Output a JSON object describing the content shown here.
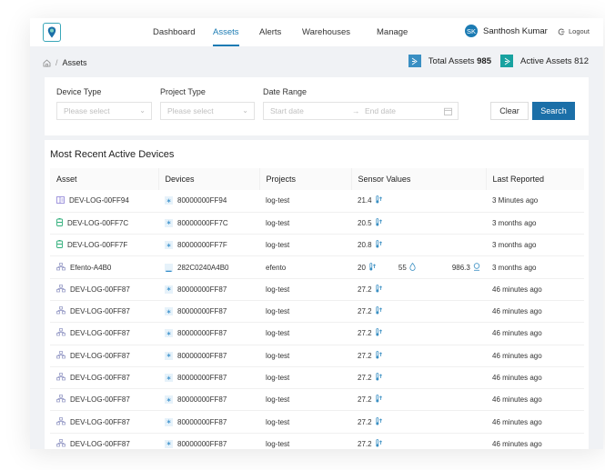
{
  "nav": {
    "items": [
      {
        "label": "Dashboard",
        "active": false
      },
      {
        "label": "Assets",
        "active": true
      },
      {
        "label": "Alerts",
        "active": false
      },
      {
        "label": "Warehouses",
        "active": false
      },
      {
        "label": "Manage",
        "active": false
      }
    ],
    "user": {
      "initials": "SK",
      "name": "Santhosh Kumar"
    },
    "logout_label": "Logout"
  },
  "breadcrumb": {
    "separator": "/",
    "current": "Assets"
  },
  "stats": {
    "total": {
      "label": "Total Assets",
      "value": "985",
      "color": "#3a8fc3"
    },
    "active": {
      "label": "Active Assets",
      "value": "812",
      "color": "#18a2a0"
    }
  },
  "filters": {
    "device_type": {
      "label": "Device Type",
      "placeholder": "Please select"
    },
    "project_type": {
      "label": "Project Type",
      "placeholder": "Please select"
    },
    "date_range": {
      "label": "Date Range",
      "start_placeholder": "Start date",
      "end_placeholder": "End date"
    },
    "clear_label": "Clear",
    "search_label": "Search"
  },
  "table": {
    "title": "Most Recent Active Devices",
    "columns": [
      "Asset",
      "Devices",
      "Projects",
      "Sensor Values",
      "Last Reported"
    ],
    "rows": [
      {
        "asset_icon": "tag-icon",
        "asset": "DEV-LOG-00FF94",
        "device_icon": "bluetooth-icon",
        "device": "80000000FF94",
        "project": "log-test",
        "sensors": [
          {
            "value": "21.4",
            "icon": "thermometer-icon"
          }
        ],
        "last": "3 Minutes ago"
      },
      {
        "asset_icon": "battery-icon",
        "asset": "DEV-LOG-00FF7C",
        "device_icon": "bluetooth-icon",
        "device": "80000000FF7C",
        "project": "log-test",
        "sensors": [
          {
            "value": "20.5",
            "icon": "thermometer-icon"
          }
        ],
        "last": "3 months ago"
      },
      {
        "asset_icon": "battery-icon",
        "asset": "DEV-LOG-00FF7F",
        "device_icon": "bluetooth-icon",
        "device": "80000000FF7F",
        "project": "log-test",
        "sensors": [
          {
            "value": "20.8",
            "icon": "thermometer-icon"
          }
        ],
        "last": "3 months ago"
      },
      {
        "asset_icon": "network-icon",
        "asset": "Efento-A4B0",
        "device_icon": "gauge-icon",
        "device": "282C0240A4B0",
        "project": "efento",
        "sensors": [
          {
            "value": "20",
            "icon": "thermometer-icon"
          },
          {
            "value": "55",
            "icon": "humidity-icon"
          },
          {
            "value": "986.3",
            "icon": "pressure-icon"
          }
        ],
        "last": "3 months ago"
      },
      {
        "asset_icon": "network-icon",
        "asset": "DEV-LOG-00FF87",
        "device_icon": "bluetooth-icon",
        "device": "80000000FF87",
        "project": "log-test",
        "sensors": [
          {
            "value": "27.2",
            "icon": "thermometer-icon"
          }
        ],
        "last": "46 minutes ago"
      },
      {
        "asset_icon": "network-icon",
        "asset": "DEV-LOG-00FF87",
        "device_icon": "bluetooth-icon",
        "device": "80000000FF87",
        "project": "log-test",
        "sensors": [
          {
            "value": "27.2",
            "icon": "thermometer-icon"
          }
        ],
        "last": "46 minutes ago"
      },
      {
        "asset_icon": "network-icon",
        "asset": "DEV-LOG-00FF87",
        "device_icon": "bluetooth-icon",
        "device": "80000000FF87",
        "project": "log-test",
        "sensors": [
          {
            "value": "27.2",
            "icon": "thermometer-icon"
          }
        ],
        "last": "46 minutes ago"
      },
      {
        "asset_icon": "network-icon",
        "asset": "DEV-LOG-00FF87",
        "device_icon": "bluetooth-icon",
        "device": "80000000FF87",
        "project": "log-test",
        "sensors": [
          {
            "value": "27.2",
            "icon": "thermometer-icon"
          }
        ],
        "last": "46 minutes ago"
      },
      {
        "asset_icon": "network-icon",
        "asset": "DEV-LOG-00FF87",
        "device_icon": "bluetooth-icon",
        "device": "80000000FF87",
        "project": "log-test",
        "sensors": [
          {
            "value": "27.2",
            "icon": "thermometer-icon"
          }
        ],
        "last": "46 minutes ago"
      },
      {
        "asset_icon": "network-icon",
        "asset": "DEV-LOG-00FF87",
        "device_icon": "bluetooth-icon",
        "device": "80000000FF87",
        "project": "log-test",
        "sensors": [
          {
            "value": "27.2",
            "icon": "thermometer-icon"
          }
        ],
        "last": "46 minutes ago"
      },
      {
        "asset_icon": "network-icon",
        "asset": "DEV-LOG-00FF87",
        "device_icon": "bluetooth-icon",
        "device": "80000000FF87",
        "project": "log-test",
        "sensors": [
          {
            "value": "27.2",
            "icon": "thermometer-icon"
          }
        ],
        "last": "46 minutes ago"
      },
      {
        "asset_icon": "network-icon",
        "asset": "DEV-LOG-00FF87",
        "device_icon": "bluetooth-icon",
        "device": "80000000FF87",
        "project": "log-test",
        "sensors": [
          {
            "value": "27.2",
            "icon": "thermometer-icon"
          }
        ],
        "last": "46 minutes ago"
      }
    ]
  }
}
